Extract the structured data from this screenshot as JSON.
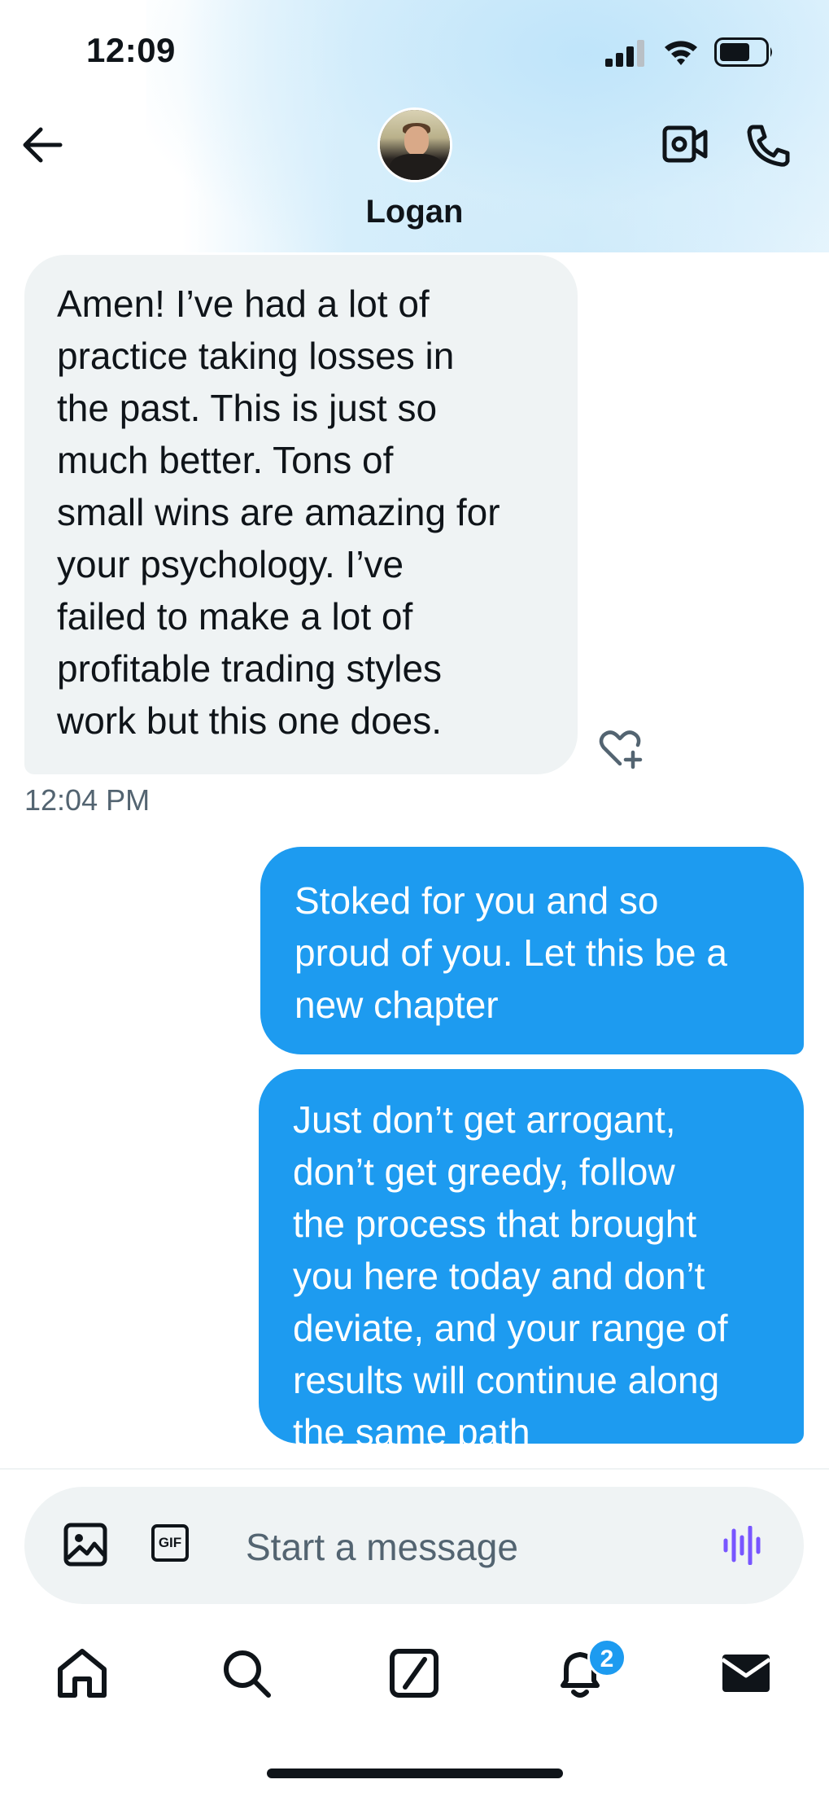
{
  "status_bar": {
    "time": "12:09",
    "icons": [
      "cellular-signal-icon",
      "wifi-icon",
      "battery-icon"
    ]
  },
  "header": {
    "contact_name": "Logan",
    "back_icon": "arrow-left-icon",
    "video_icon": "video-camera-icon",
    "call_icon": "phone-icon"
  },
  "messages": [
    {
      "direction": "received",
      "text": "Amen!  I’ve had a lot of\npractice taking losses in\nthe past.  This is just so\nmuch better.  Tons of\nsmall wins are amazing for\nyour psychology.  I’ve\nfailed to make a lot of\nprofitable trading styles\nwork but this one does.",
      "timestamp": "12:04 PM"
    },
    {
      "direction": "sent",
      "text": "Stoked for you and so\nproud of you. Let this be a\nnew chapter"
    },
    {
      "direction": "sent",
      "text": "Just don’t get arrogant,\ndon’t get greedy, follow\nthe process that brought\nyou here today and don’t\ndeviate, and your range of\nresults will continue along\nthe same path"
    }
  ],
  "composer": {
    "placeholder": "Start a message",
    "value": "",
    "gif_label": "GIF"
  },
  "bottom_nav": {
    "items": [
      "home-icon",
      "search-icon",
      "grok-icon",
      "notifications-icon",
      "messages-icon"
    ],
    "notifications_badge": "2",
    "active": "messages-icon"
  },
  "colors": {
    "accent": "#1d9bf0",
    "received_bubble": "#eff3f4",
    "text_primary": "#0f1419",
    "text_secondary": "#536471",
    "voice_accent": "#7856ff"
  }
}
